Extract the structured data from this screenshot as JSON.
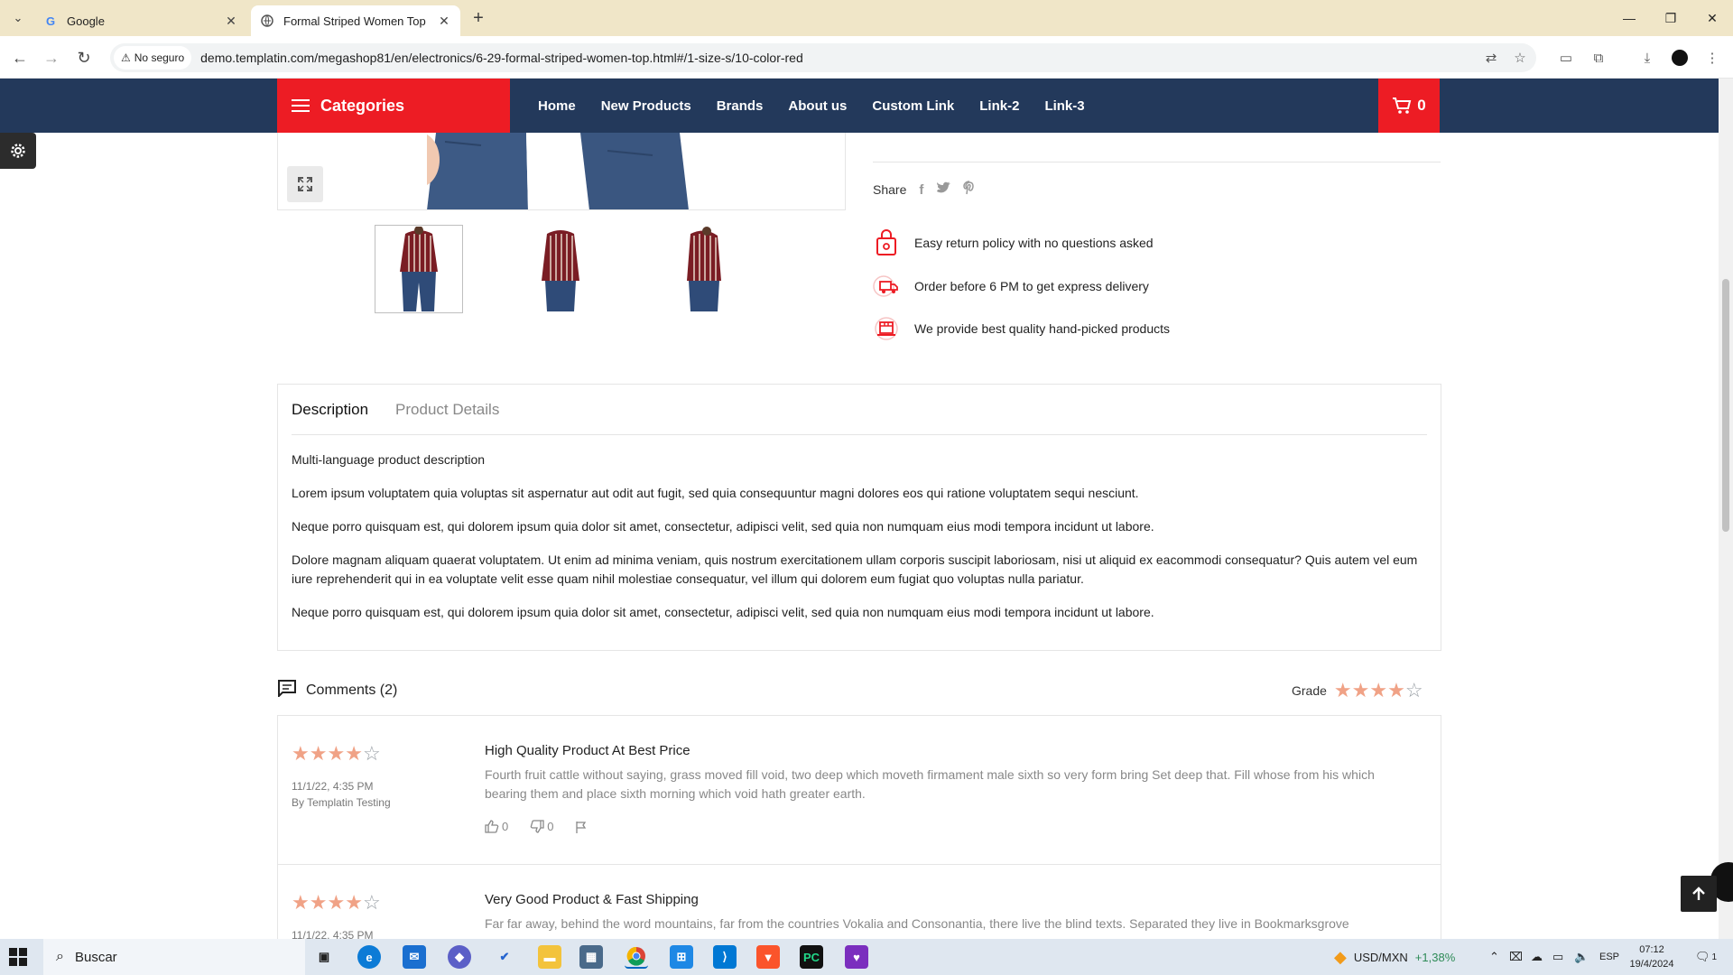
{
  "browser": {
    "tabs": [
      {
        "title": "Google",
        "active": false,
        "favicon": "google-icon"
      },
      {
        "title": "Formal Striped Women Top",
        "active": true,
        "favicon": "site-icon"
      }
    ],
    "security_label": "No seguro",
    "url": "demo.templatin.com/megashop81/en/electronics/6-29-formal-striped-women-top.html#/1-size-s/10-color-red"
  },
  "header": {
    "categories_label": "Categories",
    "menu": [
      "Home",
      "New Products",
      "Brands",
      "About us",
      "Custom Link",
      "Link-2",
      "Link-3"
    ],
    "cart_count": "0",
    "colors": {
      "navy": "#23395b",
      "red": "#ed1c24"
    }
  },
  "product": {
    "share_label": "Share",
    "share_icons": [
      "facebook-icon",
      "twitter-icon",
      "pinterest-icon"
    ],
    "features": [
      "Easy return policy with no questions asked",
      "Order before 6 PM to get express delivery",
      "We provide best quality hand-picked products"
    ],
    "thumbnail_count": 3
  },
  "description": {
    "tabs": [
      "Description",
      "Product Details"
    ],
    "heading": "Multi-language product description",
    "paragraphs": [
      "Lorem ipsum voluptatem quia voluptas sit aspernatur aut odit aut fugit, sed quia consequuntur magni dolores eos qui ratione voluptatem sequi nesciunt.",
      "Neque porro quisquam est, qui dolorem ipsum quia dolor sit amet, consectetur, adipisci velit, sed quia non numquam eius modi tempora incidunt ut labore.",
      "Dolore magnam aliquam quaerat voluptatem. Ut enim ad minima veniam, quis nostrum exercitationem ullam corporis suscipit laboriosam, nisi ut aliquid ex eacommodi consequatur? Quis autem vel eum iure reprehenderit qui in ea voluptate velit esse quam nihil molestiae consequatur, vel illum qui dolorem eum fugiat quo voluptas nulla pariatur.",
      "Neque porro quisquam est, qui dolorem ipsum quia dolor sit amet, consectetur, adipisci velit, sed quia non numquam eius modi tempora incidunt ut labore."
    ]
  },
  "comments": {
    "title": "Comments (2)",
    "grade_label": "Grade",
    "grade_stars": 4,
    "reviews": [
      {
        "stars": 4,
        "date": "11/1/22, 4:35 PM",
        "author": "By Templatin Testing",
        "title": "High Quality Product At Best Price",
        "text": "Fourth fruit cattle without saying, grass moved fill void, two deep which moveth firmament male sixth so very form bring Set deep that. Fill whose from his which bearing them and place sixth morning which void hath greater earth.",
        "likes": "0",
        "dislikes": "0"
      },
      {
        "stars": 4,
        "date": "11/1/22, 4:35 PM",
        "title": "Very Good Product & Fast Shipping",
        "text": "Far far away, behind the word mountains, far from the countries Vokalia and Consonantia, there live the blind texts. Separated they live in Bookmarksgrove"
      }
    ]
  },
  "taskbar": {
    "search_placeholder": "Buscar",
    "currency": "USD/MXN",
    "currency_change": "+1,38%",
    "language": "ESP",
    "time": "07:12",
    "date": "19/4/2024",
    "notification_count": "1"
  }
}
